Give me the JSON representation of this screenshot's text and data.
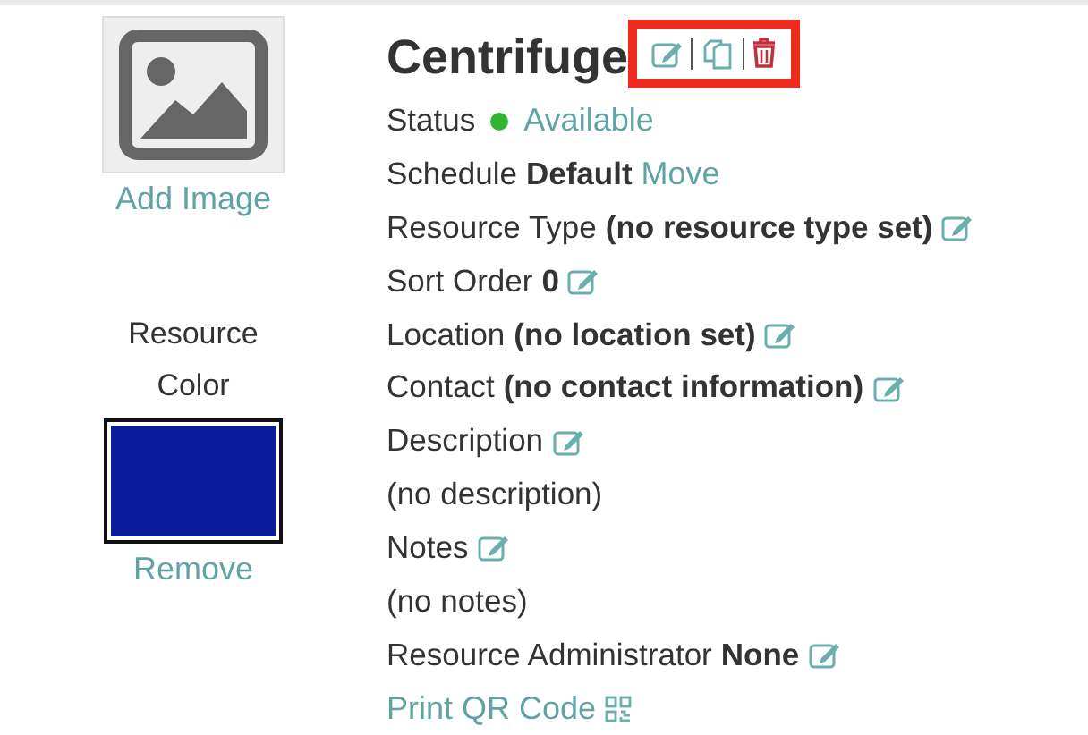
{
  "image": {
    "action": "Add Image"
  },
  "color_panel": {
    "label": "Resource Color",
    "color": "#0a1a99",
    "action": "Remove"
  },
  "resource": {
    "title": "Centrifuge",
    "actions_highlighted": true,
    "rows": [
      {
        "kind": "status",
        "label": "Status",
        "value": "Available",
        "color": "#2fb52f"
      },
      {
        "kind": "field",
        "label": "Schedule",
        "value": "Default",
        "link": "Move",
        "editable": false
      },
      {
        "kind": "field",
        "label": "Resource Type",
        "value": "(no resource type set)",
        "editable": true
      },
      {
        "kind": "field",
        "label": "Sort Order",
        "value": "0",
        "editable": true
      },
      {
        "kind": "field",
        "label": "Location",
        "value": "(no location set)",
        "editable": true
      },
      {
        "kind": "field",
        "label": "Contact",
        "value": "(no contact information)",
        "editable": true
      },
      {
        "kind": "field",
        "label": "Description",
        "editable": true
      },
      {
        "kind": "text",
        "label": "(no description)"
      },
      {
        "kind": "field",
        "label": "Notes",
        "editable": true
      },
      {
        "kind": "text",
        "label": "(no notes)"
      },
      {
        "kind": "field",
        "label": "Resource Administrator",
        "value": "None",
        "editable": true
      },
      {
        "kind": "qr",
        "label": "Print QR Code"
      }
    ]
  }
}
